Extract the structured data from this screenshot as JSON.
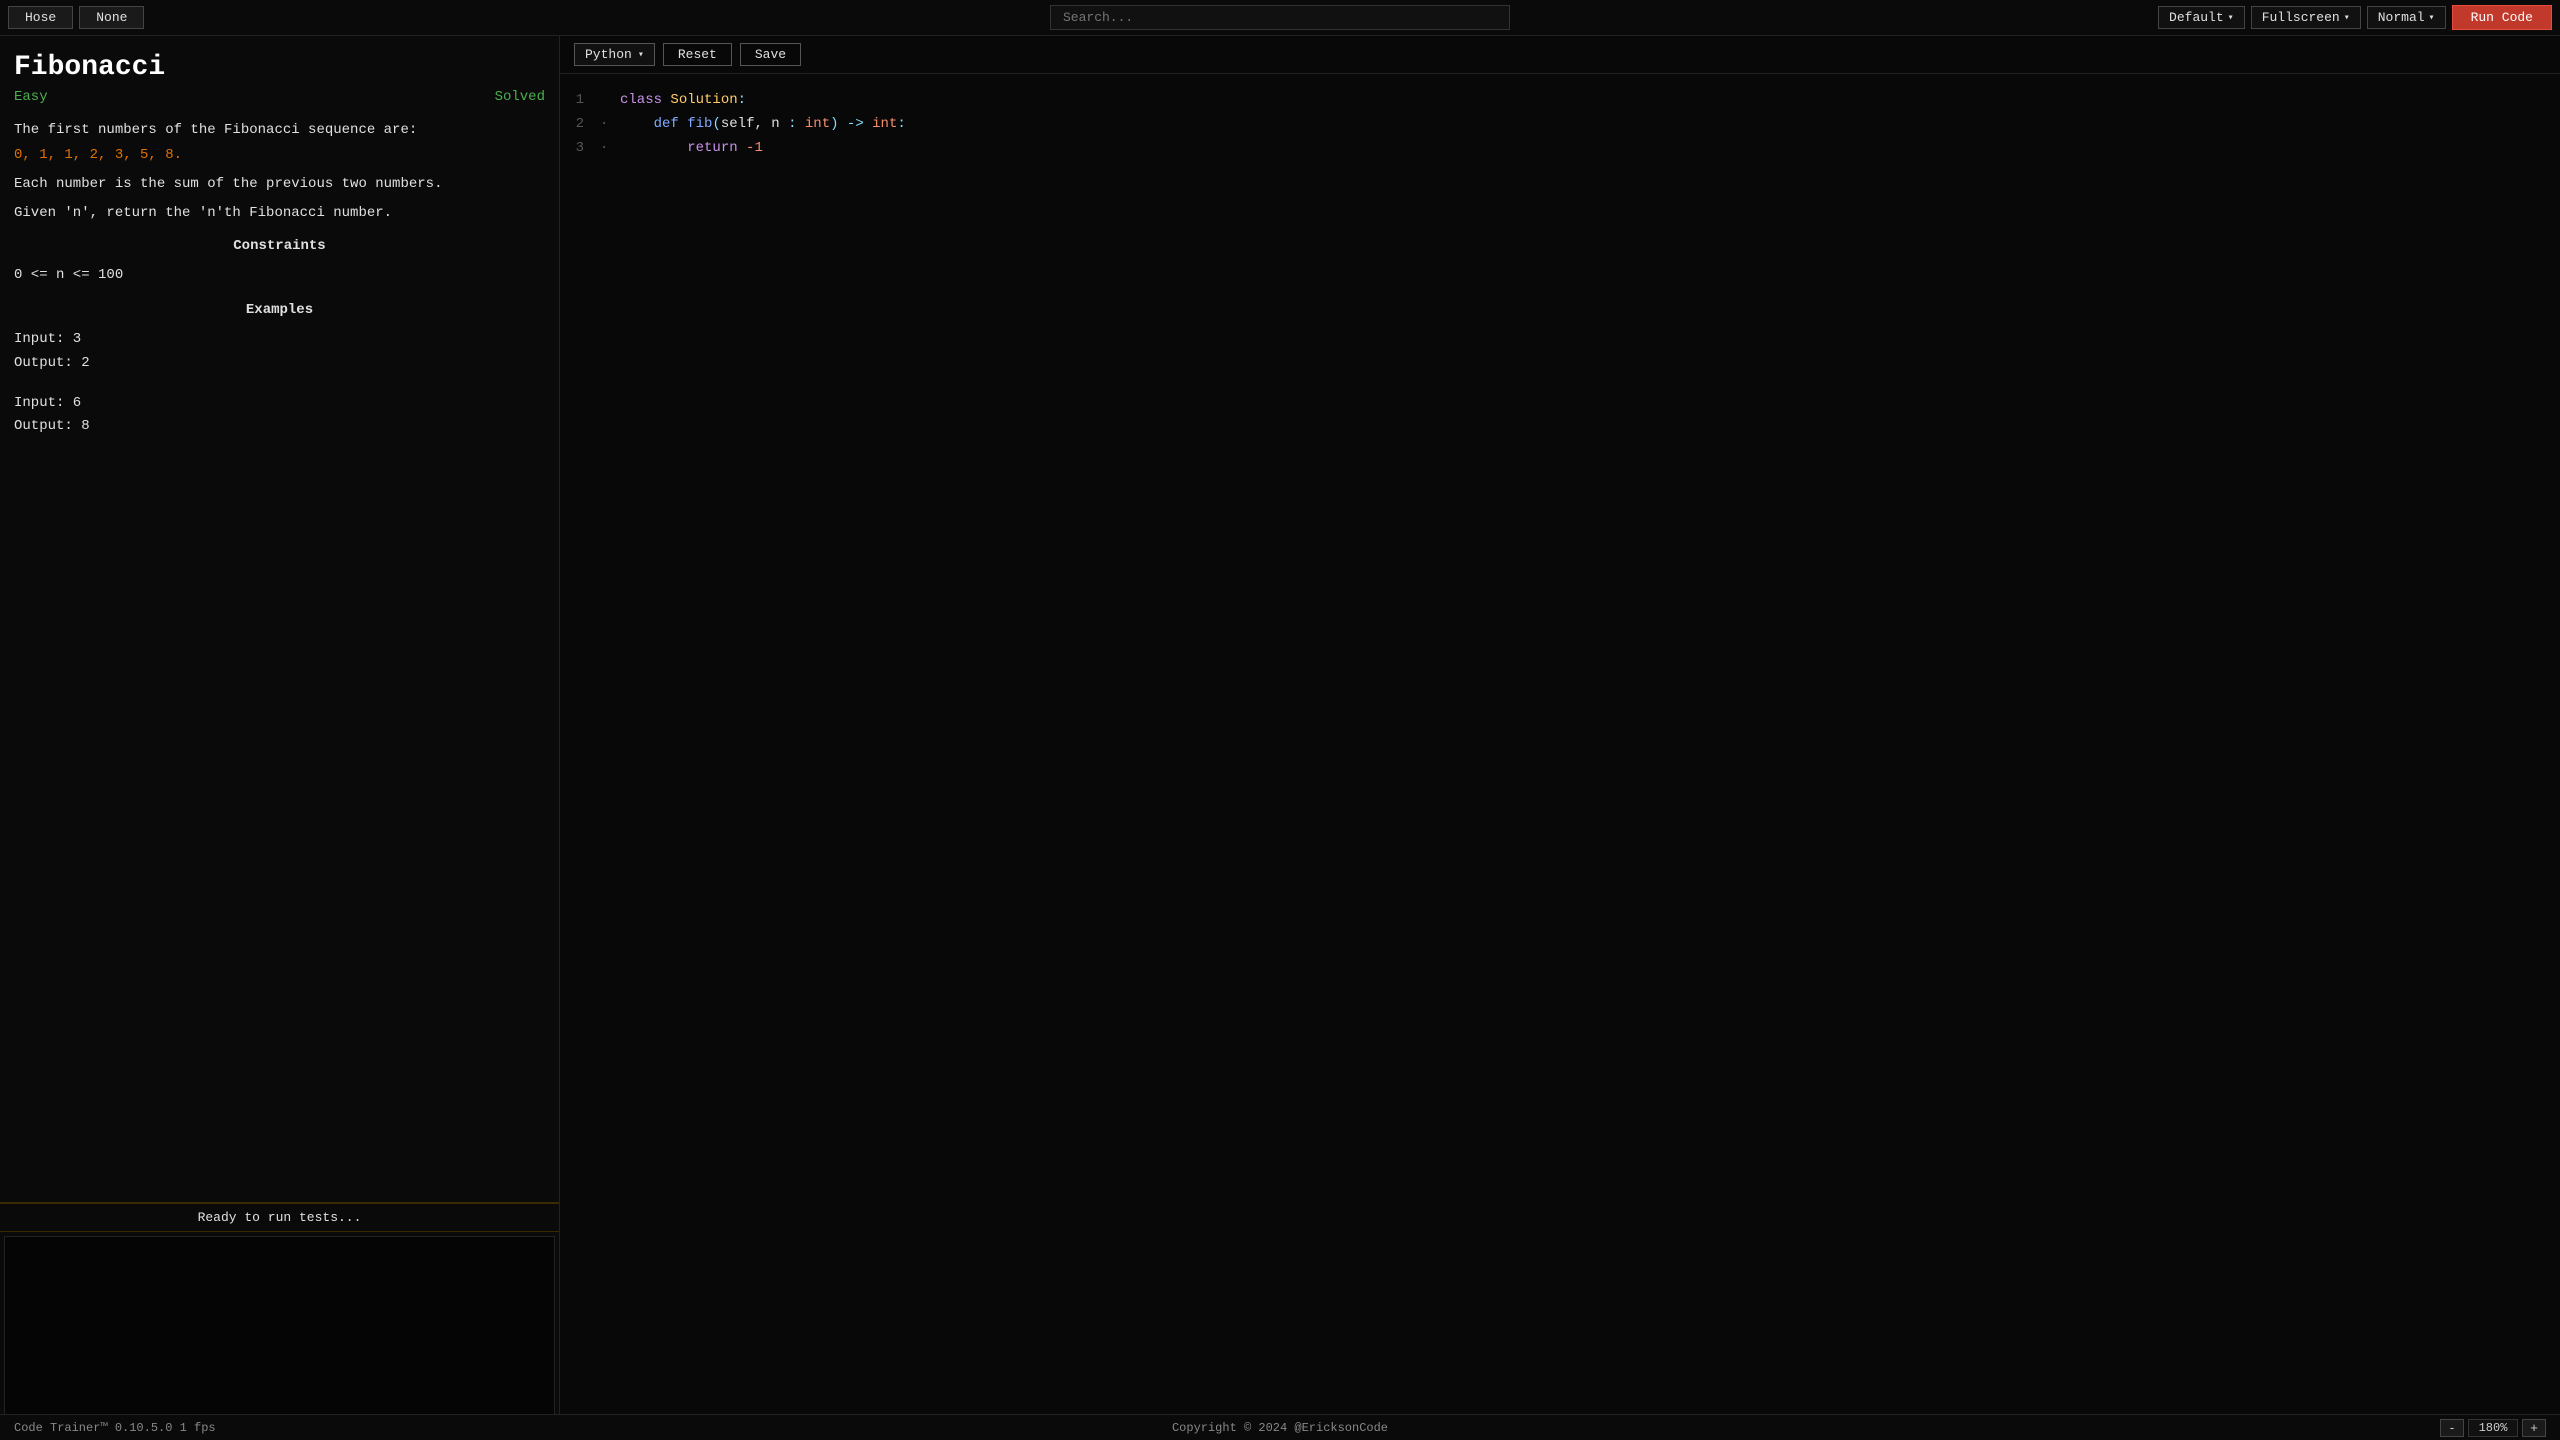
{
  "topbar": {
    "btn1": "Hose",
    "btn2": "None",
    "search_placeholder": "Search...",
    "default_label": "Default",
    "fullscreen_label": "Fullscreen",
    "normal_label": "Normal",
    "run_code_label": "Run Code"
  },
  "editor_toolbar": {
    "language": "Python",
    "reset_label": "Reset",
    "save_label": "Save"
  },
  "problem": {
    "title": "Fibonacci",
    "difficulty": "Easy",
    "status": "Solved",
    "description1": "The first numbers of the Fibonacci sequence are:",
    "sequence": "0, 1, 1, 2, 3, 5, 8.",
    "description2": "Each number is the sum of the previous two numbers.",
    "description3": "Given 'n', return the 'n'th Fibonacci number.",
    "constraints_title": "Constraints",
    "constraint1": "0 <= n <= 100",
    "examples_title": "Examples",
    "example1_input": "Input: 3",
    "example1_output": "Output: 2",
    "example2_input": "Input: 6",
    "example2_output": "Output: 8"
  },
  "status_bar": {
    "text": "Ready to run tests..."
  },
  "code": {
    "lines": [
      {
        "num": "1",
        "dot": " ",
        "content": "class Solution:"
      },
      {
        "num": "2",
        "dot": "·",
        "content": "    def fib(self, n : int) -> int:"
      },
      {
        "num": "3",
        "dot": "·",
        "content": "        return -1"
      }
    ]
  },
  "bottom_bar": {
    "left": "Code Trainer™ 0.10.5.0   1 fps",
    "center": "Copyright © 2024 @EricksonCode",
    "zoom": "180%",
    "zoom_minus": "-",
    "zoom_plus": "+"
  }
}
